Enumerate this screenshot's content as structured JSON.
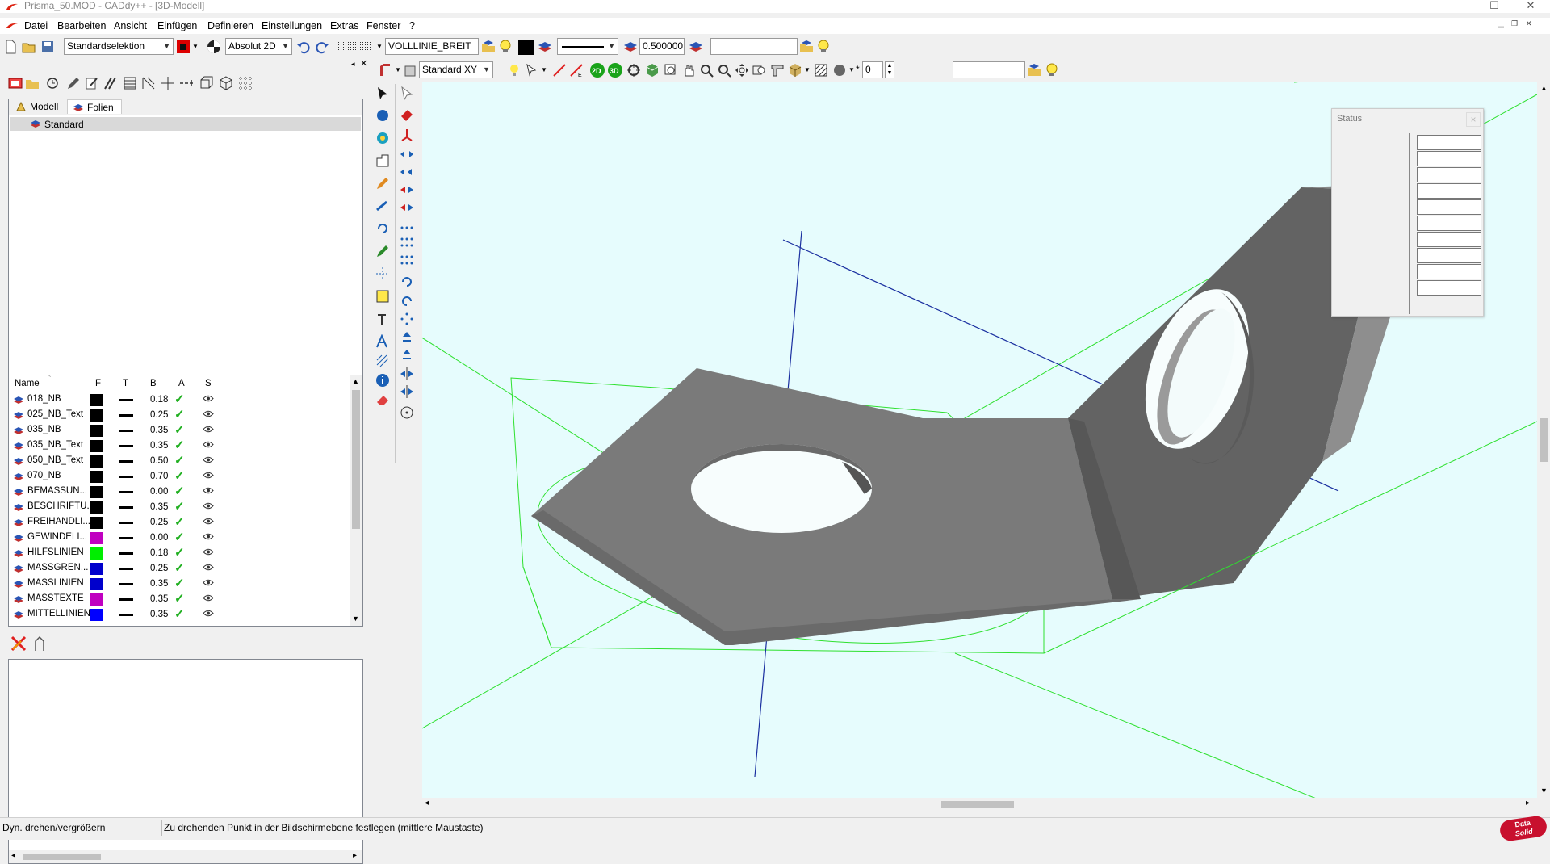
{
  "titlebar": {
    "title": "Prisma_50.MOD  -  CADdy++ - [3D-Modell]",
    "minimize": "—",
    "maximize": "☐",
    "close": "✕"
  },
  "menu": [
    {
      "label": "Datei"
    },
    {
      "label": "Bearbeiten"
    },
    {
      "label": "Ansicht"
    },
    {
      "label": "Einfügen"
    },
    {
      "label": "Definieren"
    },
    {
      "label": "Einstellungen"
    },
    {
      "label": "Extras"
    },
    {
      "label": "Fenster"
    },
    {
      "label": "?"
    }
  ],
  "toolbar1": {
    "selection_mode": "Standardselektion",
    "coord_mode": "Absolut 2D",
    "line_type": "VOLLLINIE_BREIT",
    "line_width": "0.500000",
    "search_value": ""
  },
  "toolbar2": {
    "view_plane": "Standard XY",
    "btn_2d": "2D",
    "btn_3d": "3D",
    "counter": "0",
    "search_value": ""
  },
  "tabs": [
    {
      "label": "Modell"
    },
    {
      "label": "Folien"
    }
  ],
  "tree": {
    "root": "Standard"
  },
  "layer_table": {
    "headers": {
      "name": "Name",
      "f": "F",
      "t": "T",
      "b": "B",
      "a": "A",
      "s": "S"
    },
    "rows": [
      {
        "name": "018_NB",
        "color": "#000000",
        "width": "0.18"
      },
      {
        "name": "025_NB_Text",
        "color": "#000000",
        "width": "0.25"
      },
      {
        "name": "035_NB",
        "color": "#000000",
        "width": "0.35"
      },
      {
        "name": "035_NB_Text",
        "color": "#000000",
        "width": "0.35"
      },
      {
        "name": "050_NB_Text",
        "color": "#000000",
        "width": "0.50"
      },
      {
        "name": "070_NB",
        "color": "#000000",
        "width": "0.70"
      },
      {
        "name": "BEMASSUN...",
        "color": "#000000",
        "width": "0.00"
      },
      {
        "name": "BESCHRIFTU...",
        "color": "#000000",
        "width": "0.35"
      },
      {
        "name": "FREIHANDLI...",
        "color": "#000000",
        "width": "0.25"
      },
      {
        "name": "GEWINDELI...",
        "color": "#c000c0",
        "width": "0.00"
      },
      {
        "name": "HILFSLINIEN",
        "color": "#00ee00",
        "width": "0.18"
      },
      {
        "name": "MASSGREN...",
        "color": "#0000cc",
        "width": "0.25"
      },
      {
        "name": "MASSLINIEN",
        "color": "#0000cc",
        "width": "0.35"
      },
      {
        "name": "MASSTEXTE",
        "color": "#c000c0",
        "width": "0.35"
      },
      {
        "name": "MITTELLINIEN",
        "color": "#0000ff",
        "width": "0.35"
      }
    ]
  },
  "status_window": {
    "title": "Status",
    "close": "×"
  },
  "statusbar": {
    "mode": "Dyn. drehen/vergrößern",
    "hint": "Zu drehenden Punkt in der Bildschirmebene festlegen (mittlere Maustaste)",
    "logo_top": "Data",
    "logo_bottom": "Solid"
  }
}
